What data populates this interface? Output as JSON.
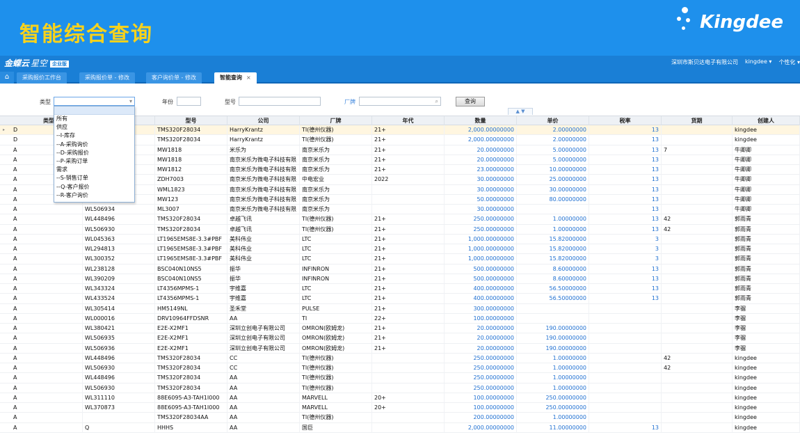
{
  "banner": {
    "title": "智能综合查询",
    "logo_text": "Kingdee"
  },
  "app": {
    "brand": "金蝶云",
    "brand_sub": "星空",
    "edition": "企业版",
    "company": "深圳市斯贝达电子有限公司",
    "user": "kingdee ▾",
    "personalize": "个性化 ▾"
  },
  "tabs": [
    {
      "label": "采购报价工作台"
    },
    {
      "label": "采购报价单 - 修改"
    },
    {
      "label": "客户询价单 - 修改"
    },
    {
      "label": "智能查询",
      "close": "×"
    }
  ],
  "filters": {
    "type_label": "类型",
    "type_value": "",
    "year_label": "年份",
    "model_label": "型号",
    "brand_label": "厂牌",
    "search_button": "查询",
    "toggle": "▲ ▼"
  },
  "dropdown": {
    "options": [
      "所有",
      "供应",
      "--I-库存",
      "--A-采购询价",
      "--D-采购报价",
      "--P-采购订单",
      "需求",
      "--S-销售订单",
      "--Q-客户报价",
      "--R-客户询价"
    ]
  },
  "table": {
    "columns": [
      "类型",
      "型号",
      "公司",
      "厂牌",
      "年代",
      "数量",
      "单价",
      "税率",
      "货期",
      "创建人"
    ],
    "rows": [
      [
        "D",
        "",
        "TMS320F28034",
        "HarryKrantz",
        "TI(德州仪器)",
        "21+",
        "2,000.00000000",
        "2.00000000",
        "13",
        "",
        "kingdee"
      ],
      [
        "D",
        "",
        "TMS320F28034",
        "HarryKrantz",
        "TI(德州仪器)",
        "21+",
        "2,000.00000000",
        "2.00000000",
        "13",
        "",
        "kingdee"
      ],
      [
        "A",
        "",
        "MW1818",
        "米乐为",
        "南京米乐为",
        "21+",
        "20.00000000",
        "5.00000000",
        "13",
        "7",
        "牛卿卿"
      ],
      [
        "A",
        "",
        "MW1818",
        "南京米乐为微电子科技有限",
        "南京米乐为",
        "21+",
        "20.00000000",
        "5.00000000",
        "13",
        "",
        "牛卿卿"
      ],
      [
        "A",
        "",
        "MW1812",
        "南京米乐为微电子科技有限",
        "南京米乐为",
        "21+",
        "23.00000000",
        "10.00000000",
        "13",
        "",
        "牛卿卿"
      ],
      [
        "A",
        "",
        "ZDH7003",
        "南京米乐为微电子科技有限",
        "中电宏业",
        "2022",
        "30.00000000",
        "25.00000000",
        "13",
        "",
        "牛卿卿"
      ],
      [
        "A",
        "",
        "WML1823",
        "南京米乐为微电子科技有限",
        "南京米乐为",
        "",
        "30.00000000",
        "30.00000000",
        "13",
        "",
        "牛卿卿"
      ],
      [
        "A",
        "",
        "MW123",
        "南京米乐为微电子科技有限",
        "南京米乐为",
        "",
        "50.00000000",
        "80.00000000",
        "13",
        "",
        "牛卿卿"
      ],
      [
        "A",
        "WL506934",
        "ML3007",
        "南京米乐为微电子科技有限",
        "南京米乐为",
        "",
        "30.00000000",
        "",
        "13",
        "",
        "牛卿卿"
      ],
      [
        "A",
        "WL448496",
        "TMS320F28034",
        "卓越飞讯",
        "TI(德州仪器)",
        "21+",
        "250.00000000",
        "1.00000000",
        "13",
        "42",
        "郭雨青"
      ],
      [
        "A",
        "WL506930",
        "TMS320F28034",
        "卓越飞讯",
        "TI(德州仪器)",
        "21+",
        "250.00000000",
        "1.00000000",
        "13",
        "42",
        "郭雨青"
      ],
      [
        "A",
        "WL045363",
        "LT1965EMS8E-3.3#PBF",
        "美科伟业",
        "LTC",
        "21+",
        "1,000.00000000",
        "15.82000000",
        "3",
        "",
        "郭雨青"
      ],
      [
        "A",
        "WL294813",
        "LT1965EMS8E-3.3#PBF",
        "美科伟业",
        "LTC",
        "21+",
        "1,000.00000000",
        "15.82000000",
        "3",
        "",
        "郭雨青"
      ],
      [
        "A",
        "WL300352",
        "LT1965EMS8E-3.3#PBF",
        "美科伟业",
        "LTC",
        "21+",
        "1,000.00000000",
        "15.82000000",
        "3",
        "",
        "郭雨青"
      ],
      [
        "A",
        "WL238128",
        "BSC040N10NS5",
        "振华",
        "INFINRON",
        "21+",
        "500.00000000",
        "8.60000000",
        "13",
        "",
        "郭雨青"
      ],
      [
        "A",
        "WL390209",
        "BSC040N10NS5",
        "振华",
        "INFINRON",
        "21+",
        "500.00000000",
        "8.60000000",
        "13",
        "",
        "郭雨青"
      ],
      [
        "A",
        "WL343324",
        "LT4356MPMS-1",
        "宇维嘉",
        "LTC",
        "21+",
        "400.00000000",
        "56.50000000",
        "13",
        "",
        "郭雨青"
      ],
      [
        "A",
        "WL433524",
        "LT4356MPMS-1",
        "宇维嘉",
        "LTC",
        "21+",
        "400.00000000",
        "56.50000000",
        "13",
        "",
        "郭雨青"
      ],
      [
        "A",
        "WL305414",
        "HM5149NL",
        "圣禾堂",
        "PULSE",
        "21+",
        "300.00000000",
        "",
        "",
        "",
        "李骝"
      ],
      [
        "A",
        "WL000016",
        "DRV10964FFDSNR",
        "AA",
        "TI",
        "22+",
        "100.00000000",
        "",
        "",
        "",
        "李骝"
      ],
      [
        "A",
        "WL380421",
        "E2E-X2MF1",
        "深圳立创电子有限公司",
        "OMRON(欧姆龙)",
        "21+",
        "20.00000000",
        "190.00000000",
        "",
        "",
        "李骝"
      ],
      [
        "A",
        "WL506935",
        "E2E-X2MF1",
        "深圳立创电子有限公司",
        "OMRON(欧姆龙)",
        "21+",
        "20.00000000",
        "190.00000000",
        "",
        "",
        "李骝"
      ],
      [
        "A",
        "WL506936",
        "E2E-X2MF1",
        "深圳立创电子有限公司",
        "OMRON(欧姆龙)",
        "21+",
        "20.00000000",
        "190.00000000",
        "",
        "",
        "李骝"
      ],
      [
        "A",
        "WL448496",
        "TMS320F28034",
        "CC",
        "TI(德州仪器)",
        "",
        "250.00000000",
        "1.00000000",
        "",
        "42",
        "kingdee"
      ],
      [
        "A",
        "WL506930",
        "TMS320F28034",
        "CC",
        "TI(德州仪器)",
        "",
        "250.00000000",
        "1.00000000",
        "",
        "42",
        "kingdee"
      ],
      [
        "A",
        "WL448496",
        "TMS320F28034",
        "AA",
        "TI(德州仪器)",
        "",
        "250.00000000",
        "1.00000000",
        "",
        "",
        "kingdee"
      ],
      [
        "A",
        "WL506930",
        "TMS320F28034",
        "AA",
        "TI(德州仪器)",
        "",
        "250.00000000",
        "1.00000000",
        "",
        "",
        "kingdee"
      ],
      [
        "A",
        "WL311110",
        "88E6095-A3-TAH1I000",
        "AA",
        "MARVELL",
        "20+",
        "100.00000000",
        "250.00000000",
        "",
        "",
        "kingdee"
      ],
      [
        "A",
        "WL370873",
        "88E6095-A3-TAH1I000",
        "AA",
        "MARVELL",
        "20+",
        "100.00000000",
        "250.00000000",
        "",
        "",
        "kingdee"
      ],
      [
        "A",
        "",
        "TMS320F28034AA",
        "AA",
        "TI(德州仪器)",
        "",
        "200.00000000",
        "1.00000000",
        "",
        "",
        "kingdee"
      ],
      [
        "A",
        "Q",
        "HHHS",
        "AA",
        "国巨",
        "",
        "2,000.00000000",
        "11.00000000",
        "13",
        "",
        "kingdee"
      ]
    ]
  },
  "colors": {
    "banner": "#1e90ec",
    "title": "#f7d21d",
    "appbar": "#1a7fd6",
    "number": "#1e6fd1"
  }
}
